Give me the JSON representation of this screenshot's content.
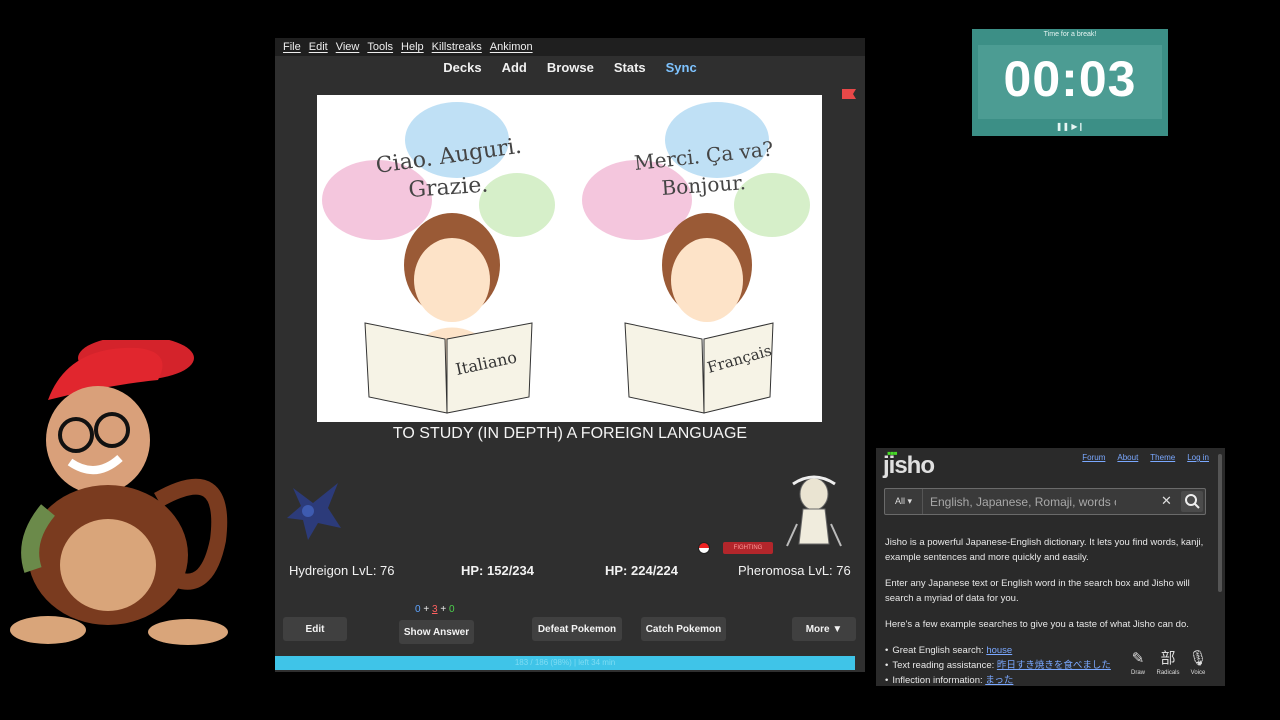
{
  "anki": {
    "menu": [
      "File",
      "Edit",
      "View",
      "Tools",
      "Help",
      "Killstreaks",
      "Ankimon"
    ],
    "toolbar": [
      "Decks",
      "Add",
      "Browse",
      "Stats",
      "Sync"
    ],
    "card_image_text": {
      "left_bubble_line1": "Ciao. Auguri.",
      "left_bubble_line2": "Grazie.",
      "left_book": "Italiano",
      "right_bubble_line1": "Merci. Ça va?",
      "right_bubble_line2": "Bonjour.",
      "right_book": "Français"
    },
    "card_text": "TO STUDY (IN DEPTH) A FOREIGN LANGUAGE",
    "battle": {
      "player_name": "Hydreigon LvL: 76",
      "player_hp": "HP: 152/234",
      "enemy_hp": "HP: 224/224",
      "enemy_name": "Pheromosa LvL: 76",
      "enemy_type": "FIGHTING"
    },
    "counts": {
      "new": "0",
      "learning": "3",
      "review": "0",
      "sep": "+"
    },
    "buttons": {
      "edit": "Edit",
      "show_answer": "Show Answer",
      "defeat": "Defeat Pokemon",
      "catch": "Catch Pokemon",
      "more": "More ▼"
    },
    "progress": {
      "text": "183 / 186 (98%) | left 34 min",
      "fraction": 0.98
    }
  },
  "timer": {
    "label": "Time for a break!",
    "time": "00:03",
    "controls": "❚❚ ▶❙"
  },
  "jisho": {
    "logo": "jisho",
    "nav": [
      "Forum",
      "About",
      "Theme",
      "Log in"
    ],
    "search": {
      "scope": "All ▾",
      "placeholder": "English, Japanese, Romaji, words or text"
    },
    "p1": "Jisho is a powerful Japanese-English dictionary. It lets you find words, kanji, example sentences and more quickly and easily.",
    "p2": "Enter any Japanese text or English word in the search box and Jisho will search a myriad of data for you.",
    "p3": "Here's a few example searches to give you a taste of what Jisho can do.",
    "examples": [
      {
        "label": "Great English search:",
        "link": "house"
      },
      {
        "label": "Text reading assistance:",
        "link": "昨日すき焼きを食べました"
      },
      {
        "label": "Inflection information:",
        "link": "まった"
      }
    ],
    "tools": [
      {
        "glyph": "✎",
        "label": "Draw"
      },
      {
        "glyph": "部",
        "label": "Radicals"
      },
      {
        "glyph": "🎙",
        "label": "Voice"
      }
    ]
  }
}
